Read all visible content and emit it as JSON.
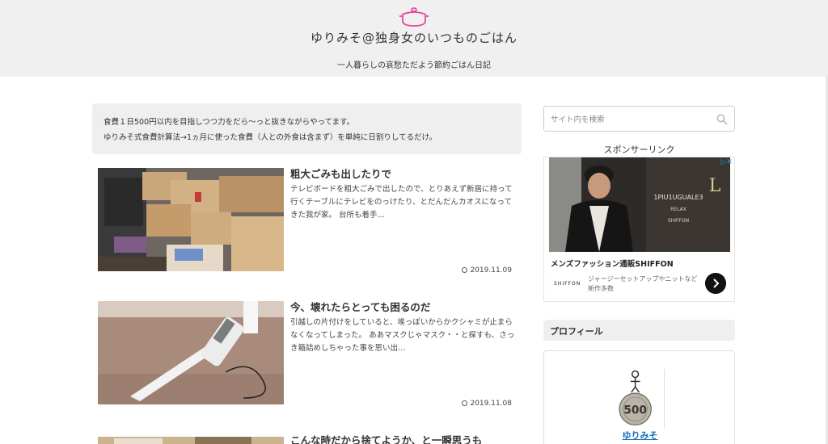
{
  "header": {
    "site_title": "ゆりみそ@独身女のいつものごはん",
    "site_description": "一人暮らしの哀愁ただよう節約ごはん日記"
  },
  "intro": {
    "line1": "食費１日500円以内を目指しつつ力をだら〜っと抜きながらやってます。",
    "line2": "ゆりみそ式食費計算法→1ヵ月に使った食費（人との外食は含まず）を単純に日割りしてるだけ。"
  },
  "articles": [
    {
      "title": "粗大ごみも出したりで",
      "excerpt": "テレビボードを粗大ごみで出したので、とりあえず新居に持って行くテーブルにテレビをのっけたり、とだんだんカオスになってきた我が家。 台所も着手...",
      "date": "2019.11.09"
    },
    {
      "title": "今、壊れたらとっても困るのだ",
      "excerpt": "引越しの片付けをしていると、埃っぽいからかクシャミが止まらなくなってしまった。 ああマスクじゃマスク・・と探すも、さっき箱詰めしちゃった事を思い出…",
      "date": "2019.11.08"
    },
    {
      "title": "こんな時だから捨てようか、と一瞬思うも",
      "excerpt": "",
      "date": ""
    }
  ],
  "sidebar": {
    "search_placeholder": "サイト内を検索",
    "sponsor_label": "スポンサーリンク",
    "ad": {
      "headline": "メンズファッション通販SHIFFON",
      "brand": "SHIFFON",
      "description": "ジャージーセットアップやニットなど新作多数"
    },
    "profile_heading": "プロフィール",
    "profile_name": "ゆりみそ"
  },
  "colors": {
    "header_bg": "#f0f0f0",
    "accent_pink": "#e5449b",
    "link_blue": "#1a6fb5"
  }
}
